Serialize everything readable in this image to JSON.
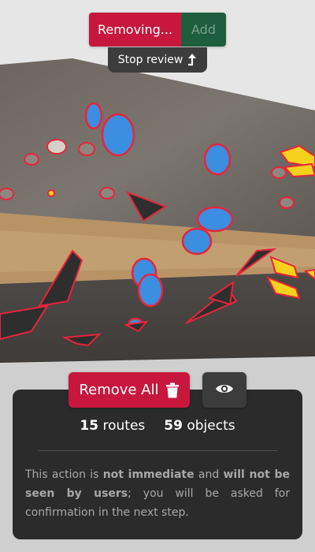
{
  "mode_toggle": {
    "removing_label": "Removing...",
    "add_label": "Add",
    "active": "removing"
  },
  "stop_review": {
    "label": "Stop review",
    "icon": "exit-arrow-icon"
  },
  "actions": {
    "remove_all_label": "Remove All",
    "remove_all_icon": "trash-icon",
    "preview_icon": "eye-icon"
  },
  "summary": {
    "routes_count": "15",
    "routes_label": "routes",
    "objects_count": "59",
    "objects_label": "objects"
  },
  "notice": {
    "part1": "This action is ",
    "bold1": "not immediate",
    "part2": " and ",
    "bold2": "will not be seen by users",
    "part3": "; you will be asked for confirmation in the next step."
  },
  "colors": {
    "remove_red": "#c8173d",
    "add_green": "#1e5e3e",
    "panel_dark": "#2b2b2b",
    "button_dark": "#3c3c3c",
    "hold_blue": "#3b8ee0",
    "hold_yellow": "#f5d21c",
    "highlight_outline": "#e8243c"
  }
}
